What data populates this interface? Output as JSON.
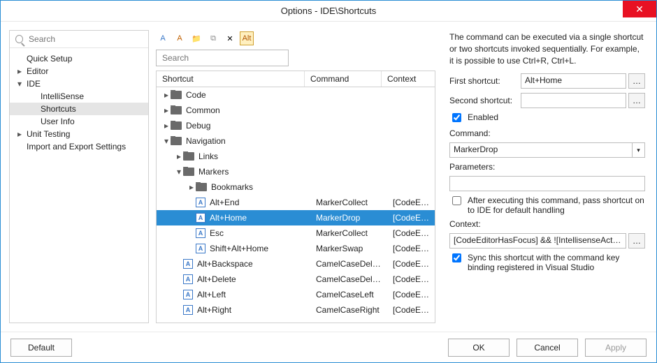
{
  "title": "Options - IDE\\Shortcuts",
  "nav": {
    "search_placeholder": "Search",
    "items": [
      {
        "label": "Quick Setup",
        "depth": 0,
        "expand": ""
      },
      {
        "label": "Editor",
        "depth": 0,
        "expand": "▸"
      },
      {
        "label": "IDE",
        "depth": 0,
        "expand": "▾"
      },
      {
        "label": "IntelliSense",
        "depth": 1,
        "expand": ""
      },
      {
        "label": "Shortcuts",
        "depth": 1,
        "expand": "",
        "selected": true
      },
      {
        "label": "User Info",
        "depth": 1,
        "expand": ""
      },
      {
        "label": "Unit Testing",
        "depth": 0,
        "expand": "▸"
      },
      {
        "label": "Import and Export Settings",
        "depth": 0,
        "expand": ""
      }
    ]
  },
  "toolbar": {
    "buttons": [
      {
        "name": "new-shortcut-icon",
        "glyph": "A",
        "color": "#3a78c8"
      },
      {
        "name": "new-shortcut-alt-icon",
        "glyph": "A",
        "color": "#c06000"
      },
      {
        "name": "new-folder-icon",
        "glyph": "📁",
        "color": "#d9a000"
      },
      {
        "name": "duplicate-icon",
        "glyph": "⧉",
        "color": "#888"
      },
      {
        "name": "delete-icon",
        "glyph": "✕",
        "color": "#000"
      },
      {
        "name": "show-conflicts-icon",
        "glyph": "Alt",
        "color": "#b05500",
        "active": true
      }
    ]
  },
  "grid": {
    "search_placeholder": "Search",
    "cols": {
      "c1": "Shortcut",
      "c2": "Command",
      "c3": "Context"
    },
    "rows": [
      {
        "kind": "folder",
        "indent": 0,
        "expand": "▸",
        "label": "Code"
      },
      {
        "kind": "folder",
        "indent": 0,
        "expand": "▸",
        "label": "Common"
      },
      {
        "kind": "folder",
        "indent": 0,
        "expand": "▸",
        "label": "Debug"
      },
      {
        "kind": "folder",
        "indent": 0,
        "expand": "▾",
        "label": "Navigation"
      },
      {
        "kind": "folder",
        "indent": 1,
        "expand": "▸",
        "label": "Links"
      },
      {
        "kind": "folder",
        "indent": 1,
        "expand": "▾",
        "label": "Markers"
      },
      {
        "kind": "folder",
        "indent": 2,
        "expand": "▸",
        "label": "Bookmarks"
      },
      {
        "kind": "item",
        "indent": 2,
        "label": "Alt+End",
        "cmd": "MarkerCollect",
        "ctx": "[CodeEdit…"
      },
      {
        "kind": "item",
        "indent": 2,
        "label": "Alt+Home",
        "cmd": "MarkerDrop",
        "ctx": "[CodeEdit…",
        "selected": true
      },
      {
        "kind": "item",
        "indent": 2,
        "label": "Esc",
        "cmd": "MarkerCollect",
        "ctx": "[CodeEdit…"
      },
      {
        "kind": "item",
        "indent": 2,
        "label": "Shift+Alt+Home",
        "cmd": "MarkerSwap",
        "ctx": "[CodeEdit…"
      },
      {
        "kind": "item",
        "indent": 1,
        "label": "Alt+Backspace",
        "cmd": "CamelCaseDel…",
        "ctx": "[CodeEdit…"
      },
      {
        "kind": "item",
        "indent": 1,
        "label": "Alt+Delete",
        "cmd": "CamelCaseDel…",
        "ctx": "[CodeEdit…"
      },
      {
        "kind": "item",
        "indent": 1,
        "label": "Alt+Left",
        "cmd": "CamelCaseLeft",
        "ctx": "[CodeEdit…"
      },
      {
        "kind": "item",
        "indent": 1,
        "label": "Alt+Right",
        "cmd": "CamelCaseRight",
        "ctx": "[CodeEdit…"
      }
    ]
  },
  "detail": {
    "desc": "The command can be executed via a single shortcut or two shortcuts invoked sequentially. For example, it is possible to use Ctrl+R, Ctrl+L.",
    "first_label": "First shortcut:",
    "first_value": "Alt+Home",
    "second_label": "Second shortcut:",
    "second_value": "",
    "enabled_label": "Enabled",
    "enabled_checked": true,
    "command_label": "Command:",
    "command_value": "MarkerDrop",
    "parameters_label": "Parameters:",
    "parameters_value": "",
    "pass_label": "After executing this command, pass shortcut on to IDE for default handling",
    "pass_checked": false,
    "context_label": "Context:",
    "context_value": "[CodeEditorHasFocus] && ![IntellisenseActive]",
    "sync_label": "Sync this shortcut with the command key binding registered in Visual Studio",
    "sync_checked": true
  },
  "footer": {
    "default": "Default",
    "ok": "OK",
    "cancel": "Cancel",
    "apply": "Apply"
  }
}
